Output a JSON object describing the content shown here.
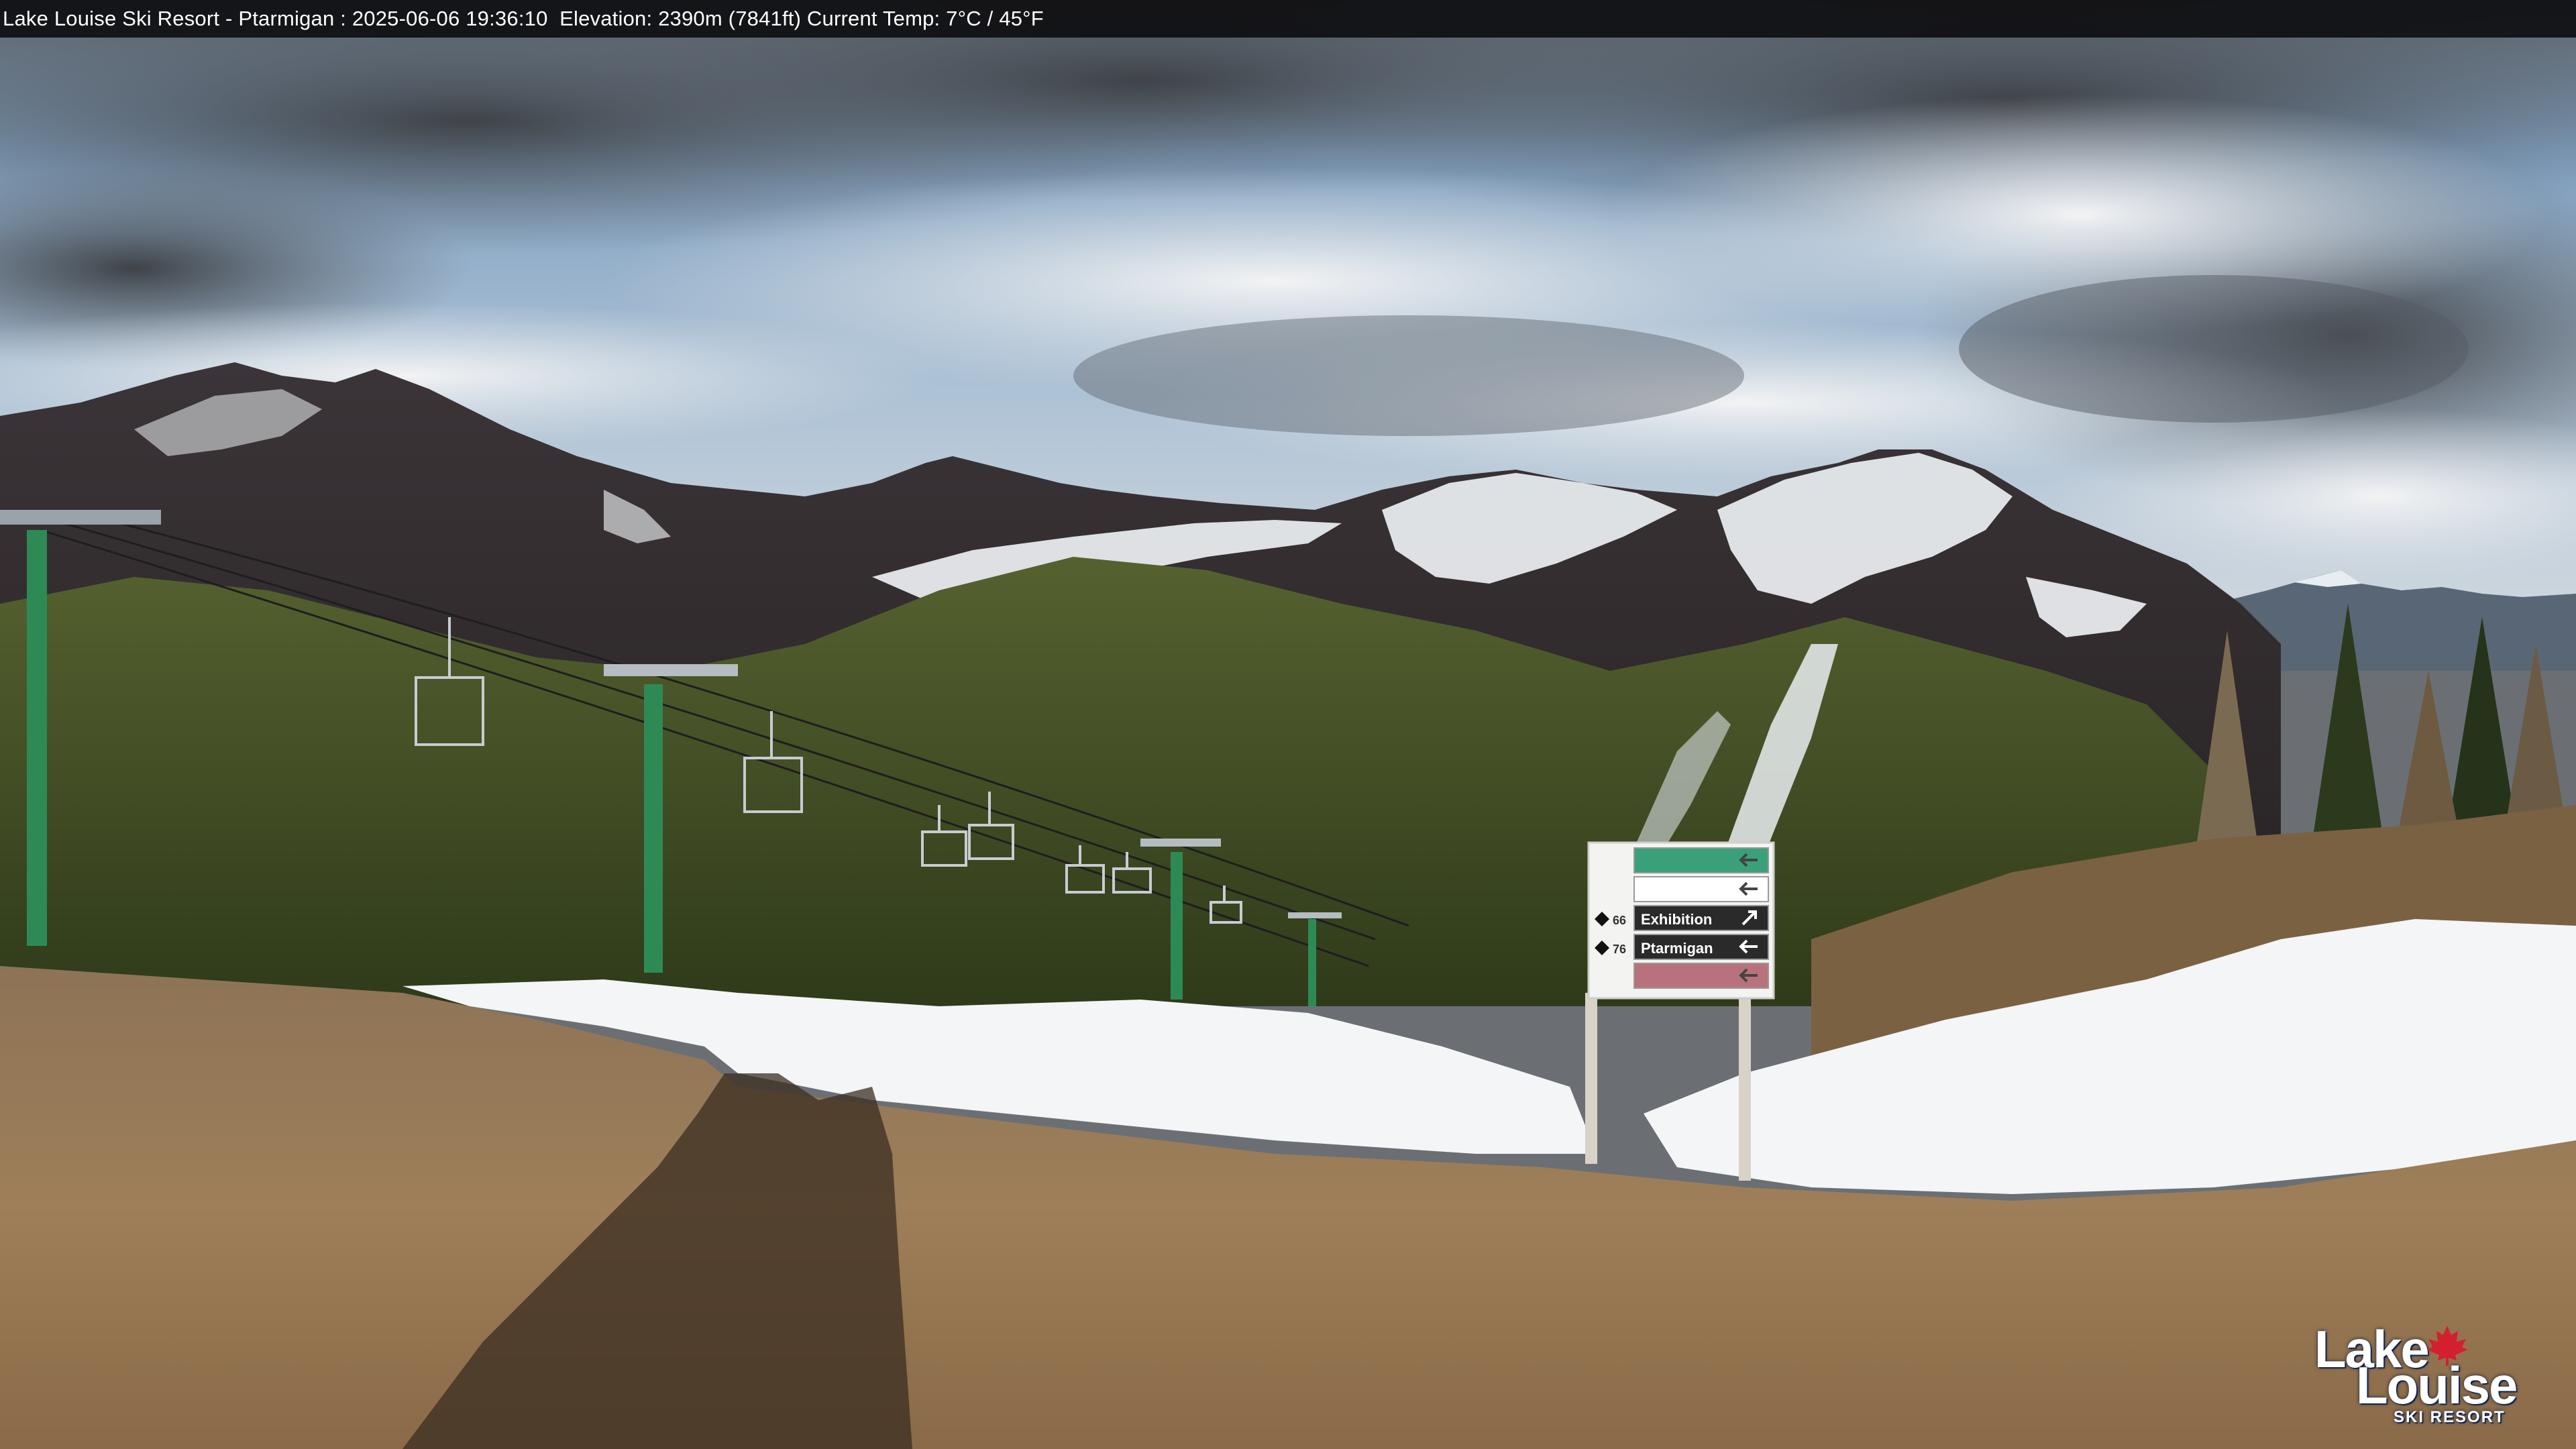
{
  "overlay": {
    "caption": "Lake Louise Ski Resort - Ptarmigan : 2025-06-06 19:36:10  Elevation: 2390m (7841ft) Current Temp: 7°C / 45°F"
  },
  "trail_sign": {
    "rows": [
      {
        "number": "",
        "name": "",
        "direction": "left",
        "color": "#3aa07a"
      },
      {
        "number": "",
        "name": "",
        "direction": "left",
        "color": "#ffffff"
      },
      {
        "number": "66",
        "name": "Exhibition",
        "direction": "up-right",
        "color": "#2a2a2a"
      },
      {
        "number": "76",
        "name": "Ptarmigan",
        "direction": "left",
        "color": "#2a2a2a"
      },
      {
        "number": "",
        "name": "",
        "direction": "left",
        "color": "#b9727d"
      }
    ]
  },
  "logo": {
    "line1": "Lake",
    "line2": "Louise",
    "line3": "SKI RESORT",
    "leaf_color": "#d2202f",
    "text_color": "#ffffff"
  },
  "colors": {
    "sky_blue": "#7fa6c9",
    "cloud_dark": "#4d5258",
    "cloud_light": "#e6e9ec",
    "snow": "#f2f4f6",
    "forest": "#3d4a22",
    "dirt": "#9c7c55",
    "lift_tower": "#2e8a55"
  }
}
